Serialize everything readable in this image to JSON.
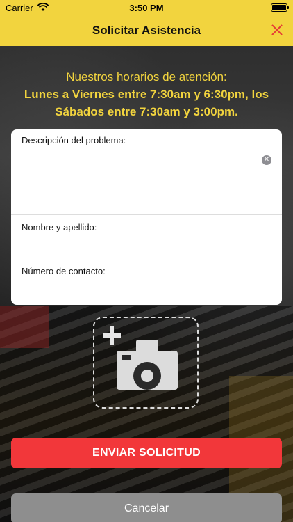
{
  "status_bar": {
    "carrier": "Carrier",
    "time": "3:50 PM"
  },
  "nav": {
    "title": "Solicitar Asistencia"
  },
  "hours": {
    "line1": "Nuestros horarios de atención:",
    "line2": "Lunes a Viernes entre 7:30am y 6:30pm, los",
    "line3": "Sábados entre 7:30am y 3:00pm."
  },
  "form": {
    "description_label": "Descripción del problema:",
    "name_label": "Nombre y apellido:",
    "contact_label": "Número de contacto:"
  },
  "buttons": {
    "send": "ENVIAR SOLICITUD",
    "cancel": "Cancelar"
  },
  "colors": {
    "accent_yellow": "#f2d43e",
    "send_red": "#f2373a",
    "close_red": "#e53935",
    "cancel_gray": "#8e8e8e"
  },
  "icons": {
    "close": "close-icon",
    "clear": "clear-icon",
    "photo": "camera-plus-icon"
  }
}
